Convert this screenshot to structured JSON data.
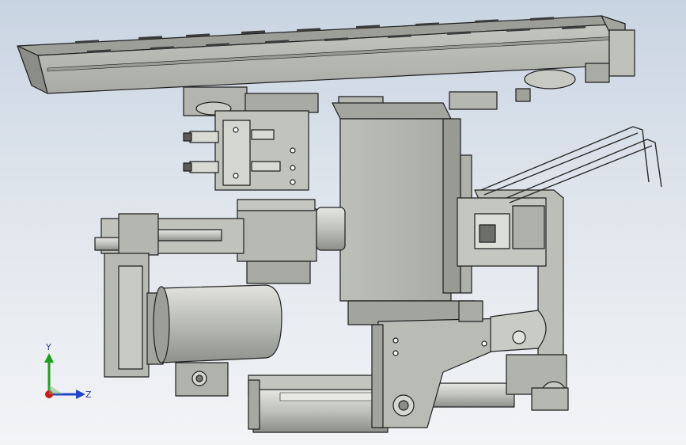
{
  "triad": {
    "y_label": "Y",
    "z_label": "Z",
    "colors": {
      "y": "#1aa31a",
      "z": "#2244cc",
      "x": "#cc1a1a"
    }
  },
  "model": {
    "fill": "#b8bab4",
    "fill_light": "#d0d2cc",
    "fill_dark": "#8e908b",
    "stroke": "#1e1e1e"
  }
}
